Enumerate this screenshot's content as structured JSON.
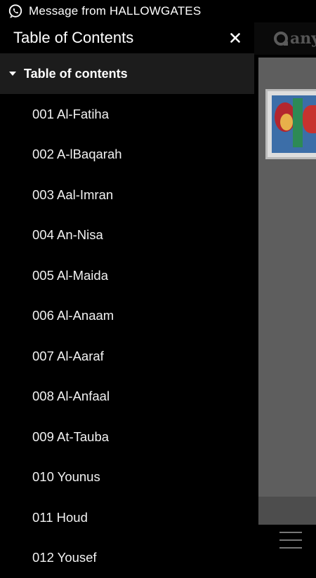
{
  "status_bar": {
    "notification_icon": "whatsapp-icon",
    "notification_text": "Message from HALLOWGATES"
  },
  "drawer": {
    "title": "Table of Contents",
    "close_icon": "close-icon",
    "section": {
      "label": "Table of contents",
      "expanded": true
    },
    "items": [
      {
        "label": "001 Al-Fatiha"
      },
      {
        "label": "002 A-lBaqarah"
      },
      {
        "label": "003 Aal-Imran"
      },
      {
        "label": "004 An-Nisa"
      },
      {
        "label": "005 Al-Maida"
      },
      {
        "label": "006 Al-Anaam"
      },
      {
        "label": "007 Al-Aaraf"
      },
      {
        "label": "008 Al-Anfaal"
      },
      {
        "label": "009 At-Tauba"
      },
      {
        "label": "010 Younus"
      },
      {
        "label": "011 Houd"
      },
      {
        "label": "012 Yousef"
      }
    ]
  },
  "background_app": {
    "logo_text": "anyf",
    "menu_icon": "hamburger-menu-icon"
  }
}
